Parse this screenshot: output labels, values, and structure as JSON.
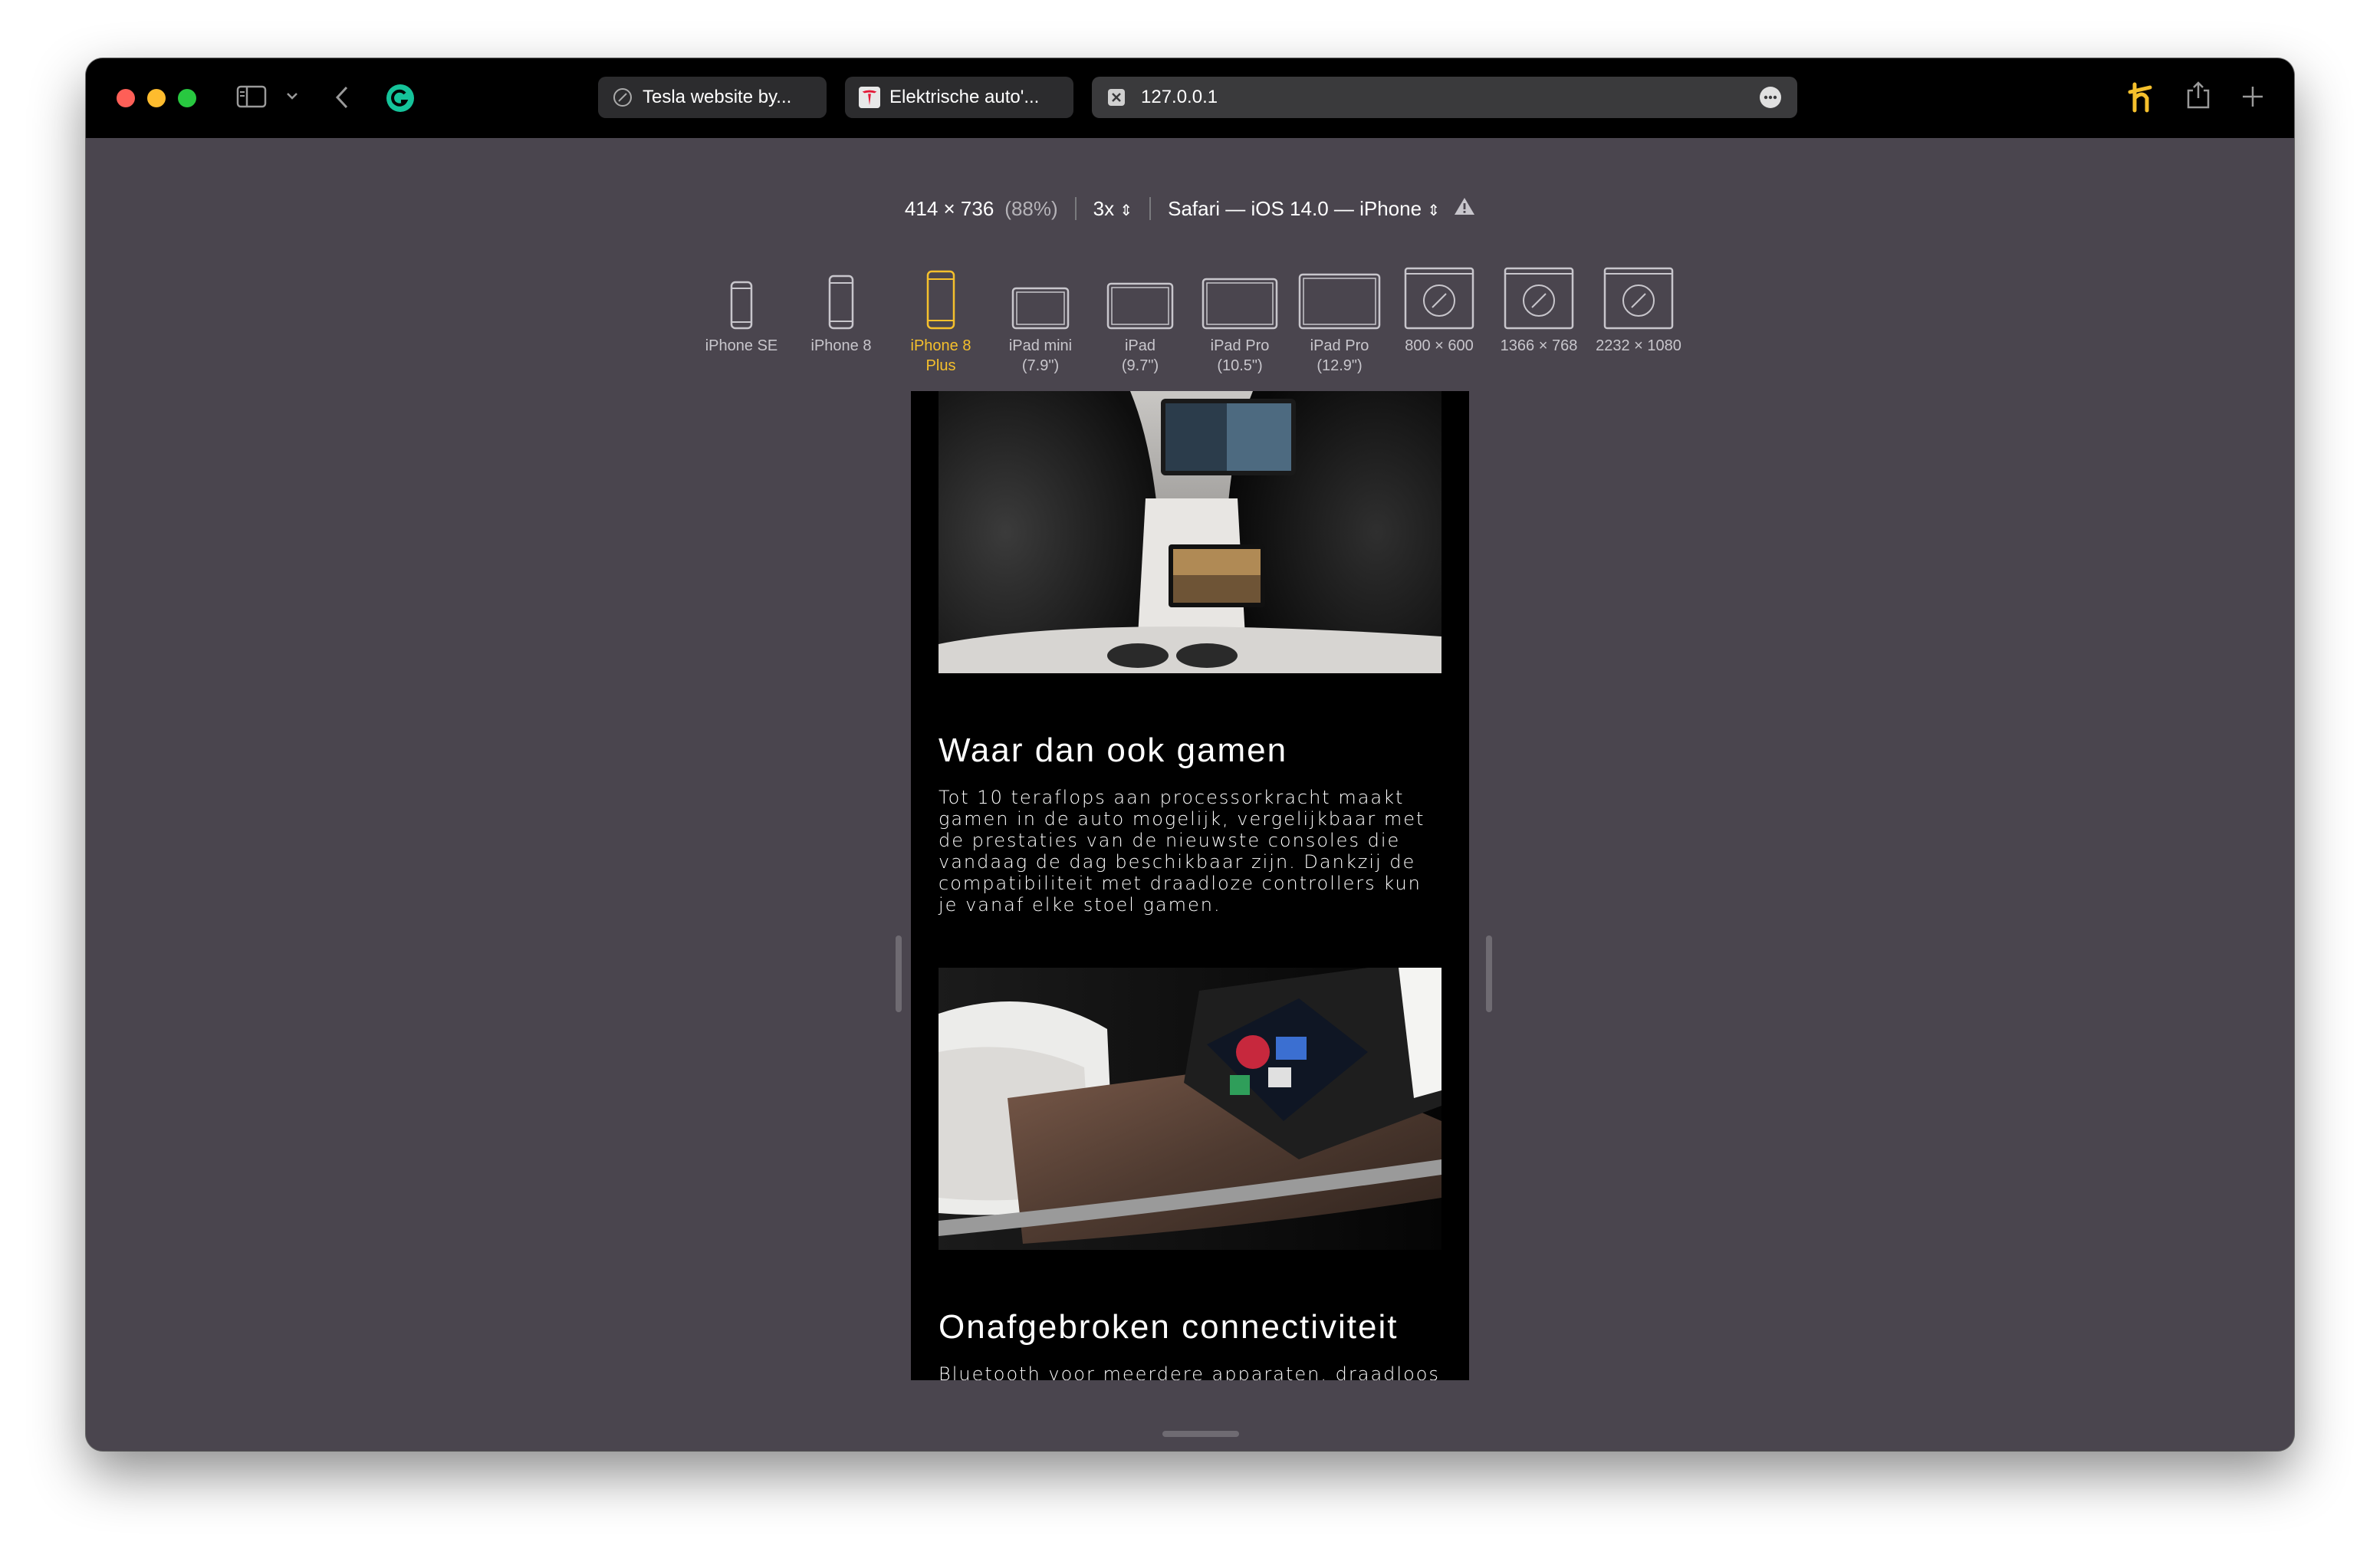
{
  "browser": {
    "tabs": [
      {
        "label": "Tesla website by...",
        "icon": "compass-icon"
      },
      {
        "label": "Elektrische auto'...",
        "icon": "tesla-logo"
      },
      {
        "label": "127.0.0.1",
        "icon": "close-icon"
      }
    ],
    "colors": {
      "accent_yellow": "#f5c02c",
      "chrome_bg": "#4a454e",
      "titlebar": "#000000"
    }
  },
  "responsive": {
    "dimensions": "414 × 736",
    "zoom": "(88%)",
    "scale": "3x",
    "user_agent": "Safari — iOS 14.0 — iPhone",
    "devices": [
      {
        "line1": "iPhone SE",
        "line2": ""
      },
      {
        "line1": "iPhone 8",
        "line2": ""
      },
      {
        "line1": "iPhone 8",
        "line2": "Plus"
      },
      {
        "line1": "iPad mini",
        "line2": "(7.9\")"
      },
      {
        "line1": "iPad",
        "line2": "(9.7\")"
      },
      {
        "line1": "iPad Pro",
        "line2": "(10.5\")"
      },
      {
        "line1": "iPad Pro",
        "line2": "(12.9\")"
      },
      {
        "line1": "800 × 600",
        "line2": ""
      },
      {
        "line1": "1366 × 768",
        "line2": ""
      },
      {
        "line1": "2232 × 1080",
        "line2": ""
      }
    ],
    "selected_device": "iPhone 8 Plus"
  },
  "page": {
    "section1": {
      "title": "Waar dan ook gamen",
      "body": "Tot 10 teraflops aan processorkracht maakt gamen in de auto mogelijk, vergelijkbaar met de prestaties van de nieuwste consoles die vandaag de dag beschikbaar zijn. Dankzij de compatibiliteit met draadloze controllers kun je vanaf elke stoel gamen."
    },
    "section2": {
      "title": "Onafgebroken connectiviteit",
      "body": "Bluetooth voor meerdere apparaten, draadloos"
    }
  }
}
